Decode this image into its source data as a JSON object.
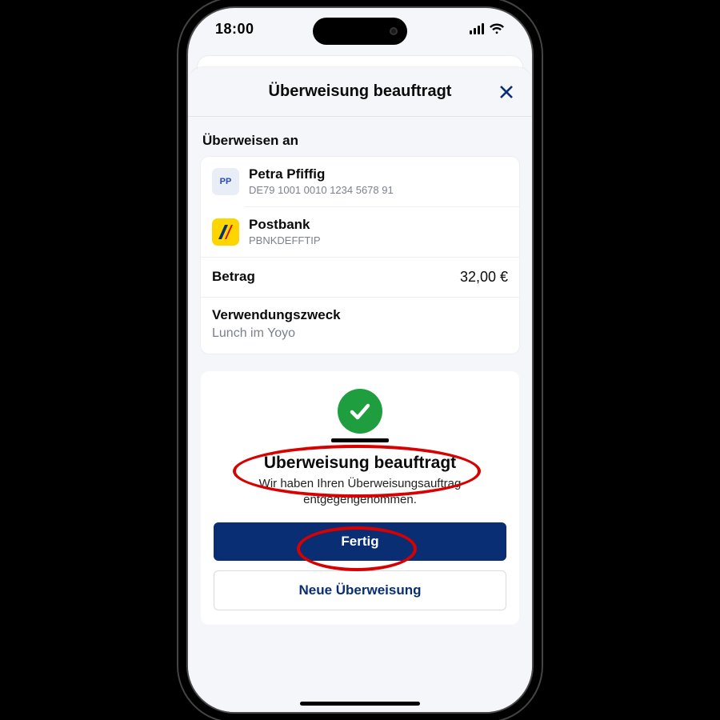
{
  "status": {
    "time": "18:00"
  },
  "sheet": {
    "title": "Überweisung beauftragt",
    "section_label": "Überweisen an"
  },
  "recipient": {
    "initials": "PP",
    "name": "Petra Pfiffig",
    "iban": "DE79 1001 0010 1234 5678 91"
  },
  "bank": {
    "name": "Postbank",
    "bic": "PBNKDEFFTIP"
  },
  "amount": {
    "label": "Betrag",
    "value": "32,00 €"
  },
  "purpose": {
    "label": "Verwendungszweck",
    "value": "Lunch im Yoyo"
  },
  "confirm": {
    "title": "Überweisung beauftragt",
    "subtitle": "Wir haben Ihren Überweisungsauftrag entgegengenommen.",
    "primary": "Fertig",
    "secondary": "Neue Überweisung"
  },
  "colors": {
    "brand_blue": "#0a2e74",
    "success_green": "#1e9e3e",
    "annot_red": "#d90000"
  }
}
